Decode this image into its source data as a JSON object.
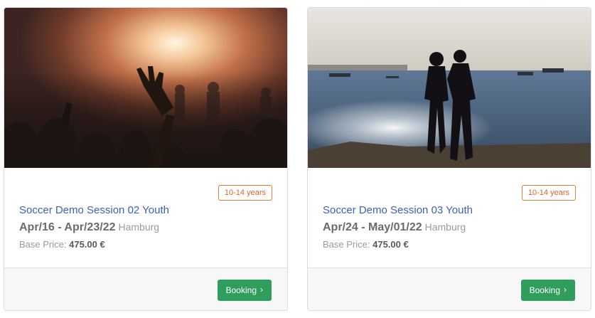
{
  "cards": [
    {
      "image_alt": "concert crowd with raised hand",
      "age_badge": "10-14 years",
      "title": "Soccer Demo Session 02 Youth",
      "dates": "Apr/16 - Apr/23/22",
      "location": "Hamburg",
      "price_label": "Base Price:",
      "price": "475.00 €",
      "button_label": "Booking",
      "button_icon": "chevron-right-icon"
    },
    {
      "image_alt": "couple silhouette by the sea at sunset",
      "age_badge": "10-14 years",
      "title": "Soccer Demo Session 03 Youth",
      "dates": "Apr/24 - May/01/22",
      "location": "Hamburg",
      "price_label": "Base Price:",
      "price": "475.00 €",
      "button_label": "Booking",
      "button_icon": "chevron-right-icon"
    }
  ],
  "colors": {
    "title_link": "#3a63b4",
    "badge": "#d8652a",
    "booking_button": "#2f9e5d"
  }
}
